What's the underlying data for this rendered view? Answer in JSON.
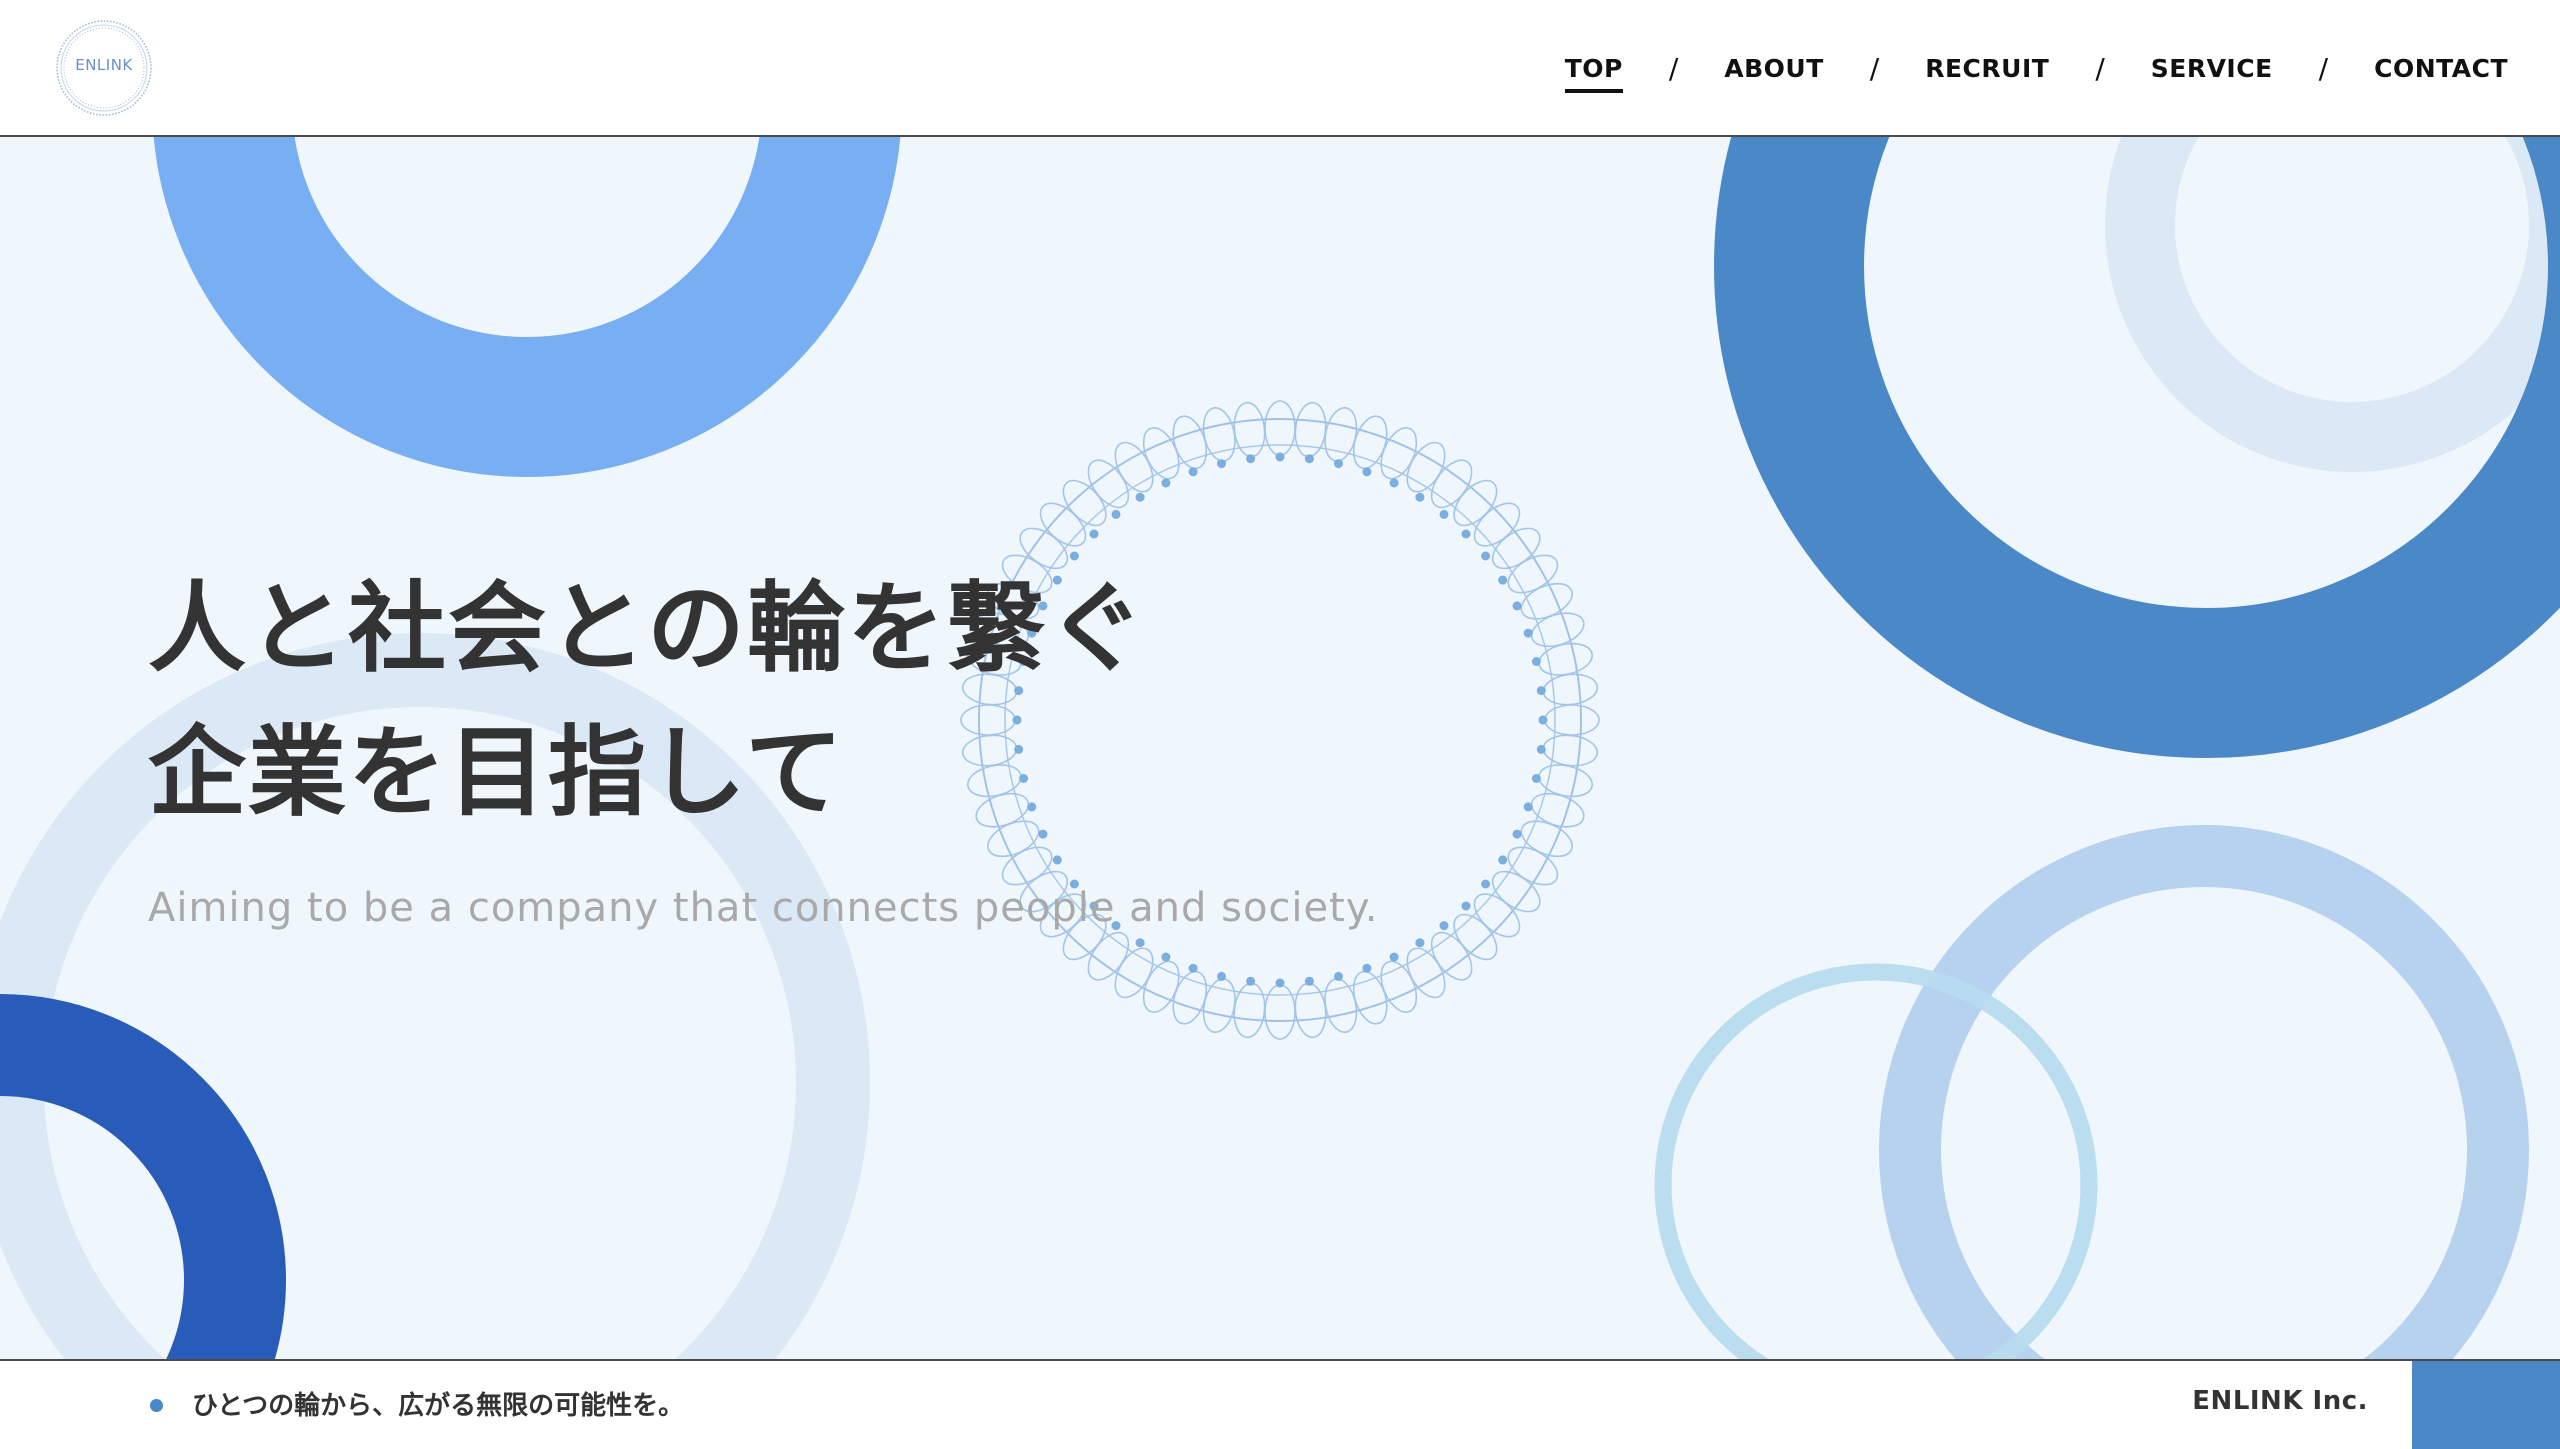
{
  "header": {
    "logo_text": "ENLINK",
    "nav": [
      {
        "label": "TOP",
        "active": true
      },
      {
        "label": "ABOUT",
        "active": false
      },
      {
        "label": "RECRUIT",
        "active": false
      },
      {
        "label": "SERVICE",
        "active": false
      },
      {
        "label": "CONTACT",
        "active": false
      }
    ],
    "separator": "/"
  },
  "hero": {
    "headline_line1": "人と社会との輪を繋ぐ",
    "headline_line2": "企業を目指して",
    "subheadline": "Aiming to be a company that connects people and society."
  },
  "footer_bar": {
    "tagline": "ひとつの輪から、広がる無限の可能性を。",
    "company": "ENLINK Inc."
  },
  "colors": {
    "hero_background": "#eff6fc",
    "accent_blue": "#4a88c7",
    "light_blue": "#78aff2",
    "deep_blue": "#285cb8",
    "pale_blue": "#dbe8f6",
    "soft_blue": "#b7d2ef",
    "sky_blue": "#b7dbef",
    "text_dark": "#333333",
    "text_muted": "#a9a9a9"
  },
  "icons": {
    "logo": "enlink-ring-logo",
    "center_ornament": "lace-ring-ornament",
    "bullet": "dot-icon"
  }
}
